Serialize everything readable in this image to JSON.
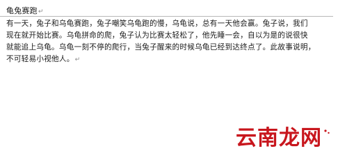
{
  "document": {
    "title": "龟兔赛跑",
    "paragraph_mark": "↵",
    "lines": [
      "有一天，兔子和乌龟赛跑，兔子嘲笑乌龟跑的慢，乌龟说，总有一天他会赢。兔子说，我们",
      "现在就开始比赛。乌龟拼命的爬，兔子认为比赛太轻松了，他先睡一会，自以为是的说很快",
      "就能追上乌龟。乌龟一刻不停的爬行，当兔子醒来的时候乌龟已经到达终点了。此故事说明，",
      "不可轻易小视他人。"
    ]
  },
  "watermark": {
    "text": "云南龙网",
    "color": "#c8161d"
  }
}
